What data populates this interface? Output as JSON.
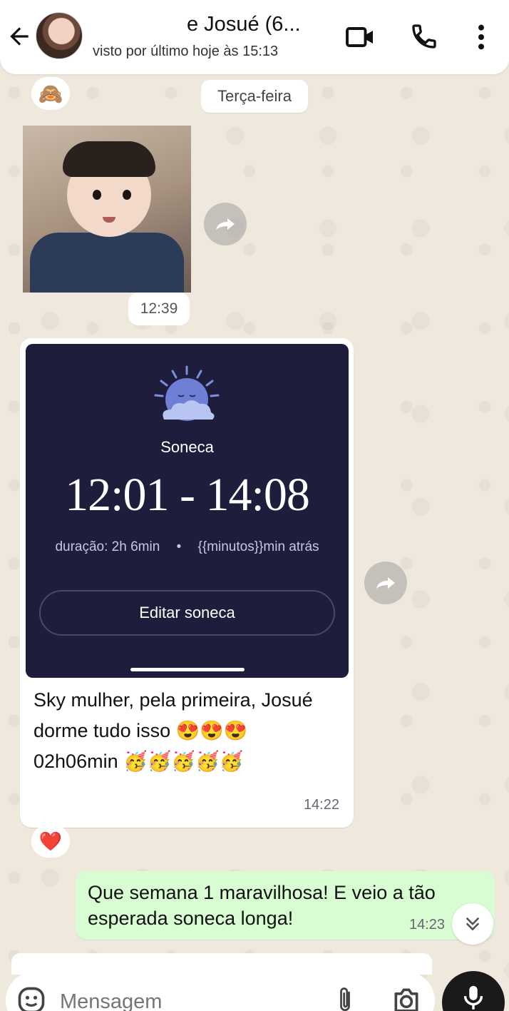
{
  "header": {
    "title": "e Josué (6...",
    "subtitle": "visto por último hoje às 15:13"
  },
  "chat": {
    "date_label": "Terça-feira",
    "sticker_reaction": "🙈",
    "sticker_time": "12:39",
    "nap_card": {
      "label": "Soneca",
      "times": "12:01 - 14:08",
      "duration": "duração: 2h 6min",
      "separator": "•",
      "ago": "{{minutos}}min atrás",
      "edit_label": "Editar soneca"
    },
    "incoming_text_line1": "Sky mulher, pela primeira, Josué",
    "incoming_text_line2": "dorme tudo isso 😍😍😍",
    "incoming_text_line3": "02h06min 🥳🥳🥳🥳🥳",
    "incoming_time": "14:22",
    "incoming_reaction": "❤️",
    "outgoing_text": "Que semana 1 maravilhosa! E veio a tão esperada soneca longa!",
    "outgoing_time": "14:23"
  },
  "composer": {
    "placeholder": "Mensagem"
  },
  "colors": {
    "outgoing_bubble": "#d8fdd2",
    "nap_card_bg": "#1f1d3c",
    "wallpaper": "#efe8dc"
  },
  "icons": [
    "back-arrow-icon",
    "video-call-icon",
    "phone-icon",
    "more-vert-icon",
    "forward-icon",
    "chevrons-down-icon",
    "emoji-icon",
    "paperclip-icon",
    "camera-icon",
    "mic-icon"
  ]
}
